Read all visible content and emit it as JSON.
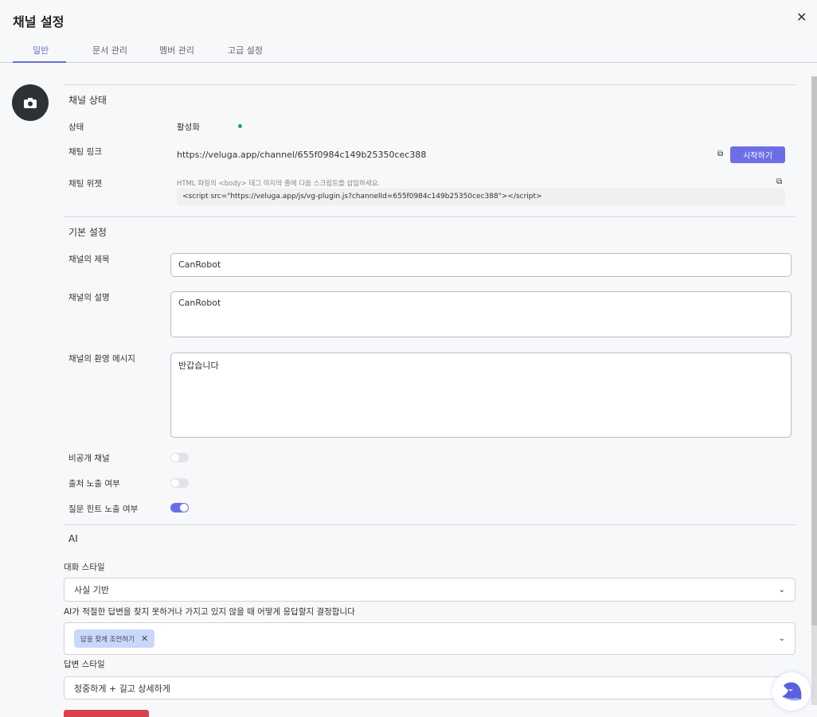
{
  "header": {
    "title": "채널 설정",
    "close_icon": "close-icon"
  },
  "tabs": [
    {
      "label": "일반",
      "active": true
    },
    {
      "label": "문서 관리"
    },
    {
      "label": "멤버 관리"
    },
    {
      "label": "고급 설정"
    }
  ],
  "status": {
    "heading": "채널 상태",
    "state_label": "상태",
    "state_value": "활성화",
    "state_color": "#2e9d5b",
    "link_label": "채팅 링크",
    "link_value": "https://veluga.app/channel/655f0984c149b25350cec388",
    "start_button": "시작하기",
    "widget_label": "채팅 위젯",
    "widget_hint": "HTML 파일의 <body> 태그 마지막 줄에 다음 스크립트를 삽입하세요.",
    "widget_code": "<script src=\"https://veluga.app/js/vg-plugin.js?channelId=655f0984c149b25350cec388\"></script>"
  },
  "basic": {
    "heading": "기본 설정",
    "title_label": "채널의 제목",
    "title_value": "CanRobot",
    "desc_label": "채널의 설명",
    "desc_value": "CanRobot",
    "welcome_label": "채널의 환영 메시지",
    "welcome_value": "반갑습니다",
    "private_label": "비공개 채널",
    "private_on": false,
    "source_label": "출처 노출 여부",
    "source_on": false,
    "hint_label": "질문 힌트 노출 여부",
    "hint_on": true
  },
  "ai": {
    "heading": "AI",
    "style_label": "대화 스타일",
    "style_value": "사실 기반",
    "fallback_label": "AI가 적절한 답변을 찾지 못하거나 가지고 있지 않을 때 어떻게 응답할지 결정합니다",
    "fallback_chip": "답을 찾게 조언하기",
    "answer_label": "답변 스타일",
    "answer_value": "정중하게 + 길고 상세하게"
  },
  "colors": {
    "accent": "#6c6ee8",
    "danger": "#d9434e"
  }
}
